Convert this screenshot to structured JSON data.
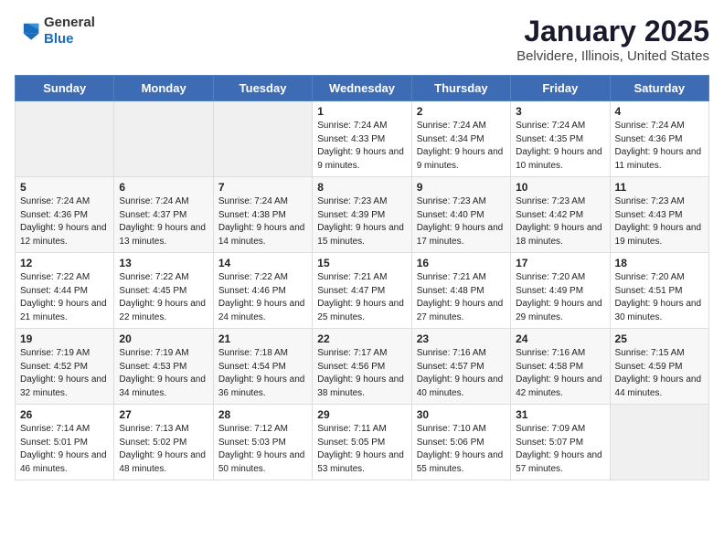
{
  "logo": {
    "general": "General",
    "blue": "Blue"
  },
  "title": "January 2025",
  "subtitle": "Belvidere, Illinois, United States",
  "weekdays": [
    "Sunday",
    "Monday",
    "Tuesday",
    "Wednesday",
    "Thursday",
    "Friday",
    "Saturday"
  ],
  "weeks": [
    [
      {
        "day": "",
        "empty": true
      },
      {
        "day": "",
        "empty": true
      },
      {
        "day": "",
        "empty": true
      },
      {
        "day": "1",
        "sunrise": "7:24 AM",
        "sunset": "4:33 PM",
        "daylight": "9 hours and 9 minutes."
      },
      {
        "day": "2",
        "sunrise": "7:24 AM",
        "sunset": "4:34 PM",
        "daylight": "9 hours and 9 minutes."
      },
      {
        "day": "3",
        "sunrise": "7:24 AM",
        "sunset": "4:35 PM",
        "daylight": "9 hours and 10 minutes."
      },
      {
        "day": "4",
        "sunrise": "7:24 AM",
        "sunset": "4:36 PM",
        "daylight": "9 hours and 11 minutes."
      }
    ],
    [
      {
        "day": "5",
        "sunrise": "7:24 AM",
        "sunset": "4:36 PM",
        "daylight": "9 hours and 12 minutes."
      },
      {
        "day": "6",
        "sunrise": "7:24 AM",
        "sunset": "4:37 PM",
        "daylight": "9 hours and 13 minutes."
      },
      {
        "day": "7",
        "sunrise": "7:24 AM",
        "sunset": "4:38 PM",
        "daylight": "9 hours and 14 minutes."
      },
      {
        "day": "8",
        "sunrise": "7:23 AM",
        "sunset": "4:39 PM",
        "daylight": "9 hours and 15 minutes."
      },
      {
        "day": "9",
        "sunrise": "7:23 AM",
        "sunset": "4:40 PM",
        "daylight": "9 hours and 17 minutes."
      },
      {
        "day": "10",
        "sunrise": "7:23 AM",
        "sunset": "4:42 PM",
        "daylight": "9 hours and 18 minutes."
      },
      {
        "day": "11",
        "sunrise": "7:23 AM",
        "sunset": "4:43 PM",
        "daylight": "9 hours and 19 minutes."
      }
    ],
    [
      {
        "day": "12",
        "sunrise": "7:22 AM",
        "sunset": "4:44 PM",
        "daylight": "9 hours and 21 minutes."
      },
      {
        "day": "13",
        "sunrise": "7:22 AM",
        "sunset": "4:45 PM",
        "daylight": "9 hours and 22 minutes."
      },
      {
        "day": "14",
        "sunrise": "7:22 AM",
        "sunset": "4:46 PM",
        "daylight": "9 hours and 24 minutes."
      },
      {
        "day": "15",
        "sunrise": "7:21 AM",
        "sunset": "4:47 PM",
        "daylight": "9 hours and 25 minutes."
      },
      {
        "day": "16",
        "sunrise": "7:21 AM",
        "sunset": "4:48 PM",
        "daylight": "9 hours and 27 minutes."
      },
      {
        "day": "17",
        "sunrise": "7:20 AM",
        "sunset": "4:49 PM",
        "daylight": "9 hours and 29 minutes."
      },
      {
        "day": "18",
        "sunrise": "7:20 AM",
        "sunset": "4:51 PM",
        "daylight": "9 hours and 30 minutes."
      }
    ],
    [
      {
        "day": "19",
        "sunrise": "7:19 AM",
        "sunset": "4:52 PM",
        "daylight": "9 hours and 32 minutes."
      },
      {
        "day": "20",
        "sunrise": "7:19 AM",
        "sunset": "4:53 PM",
        "daylight": "9 hours and 34 minutes."
      },
      {
        "day": "21",
        "sunrise": "7:18 AM",
        "sunset": "4:54 PM",
        "daylight": "9 hours and 36 minutes."
      },
      {
        "day": "22",
        "sunrise": "7:17 AM",
        "sunset": "4:56 PM",
        "daylight": "9 hours and 38 minutes."
      },
      {
        "day": "23",
        "sunrise": "7:16 AM",
        "sunset": "4:57 PM",
        "daylight": "9 hours and 40 minutes."
      },
      {
        "day": "24",
        "sunrise": "7:16 AM",
        "sunset": "4:58 PM",
        "daylight": "9 hours and 42 minutes."
      },
      {
        "day": "25",
        "sunrise": "7:15 AM",
        "sunset": "4:59 PM",
        "daylight": "9 hours and 44 minutes."
      }
    ],
    [
      {
        "day": "26",
        "sunrise": "7:14 AM",
        "sunset": "5:01 PM",
        "daylight": "9 hours and 46 minutes."
      },
      {
        "day": "27",
        "sunrise": "7:13 AM",
        "sunset": "5:02 PM",
        "daylight": "9 hours and 48 minutes."
      },
      {
        "day": "28",
        "sunrise": "7:12 AM",
        "sunset": "5:03 PM",
        "daylight": "9 hours and 50 minutes."
      },
      {
        "day": "29",
        "sunrise": "7:11 AM",
        "sunset": "5:05 PM",
        "daylight": "9 hours and 53 minutes."
      },
      {
        "day": "30",
        "sunrise": "7:10 AM",
        "sunset": "5:06 PM",
        "daylight": "9 hours and 55 minutes."
      },
      {
        "day": "31",
        "sunrise": "7:09 AM",
        "sunset": "5:07 PM",
        "daylight": "9 hours and 57 minutes."
      },
      {
        "day": "",
        "empty": true
      }
    ]
  ]
}
